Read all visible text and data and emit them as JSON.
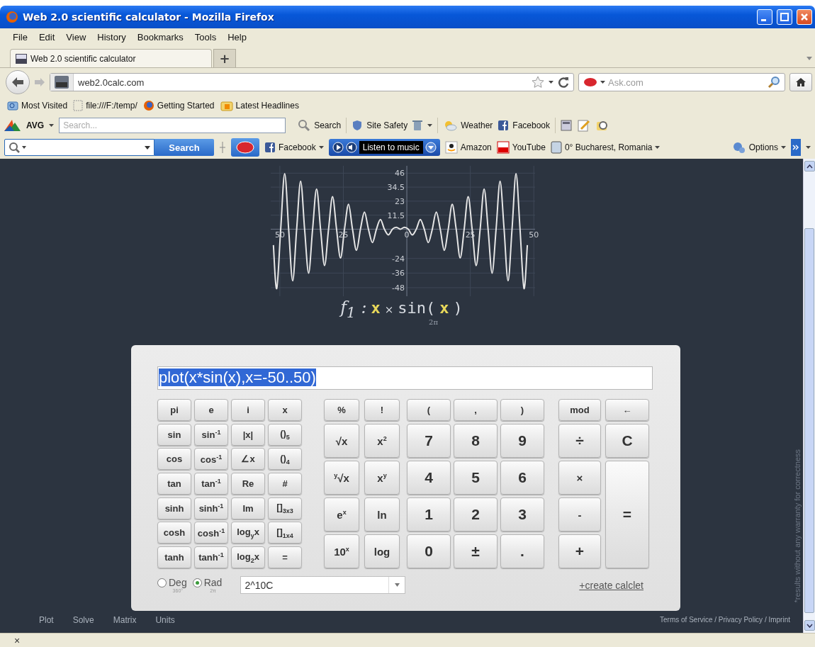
{
  "window": {
    "title": "Web 2.0 scientific calculator - Mozilla Firefox"
  },
  "menu": [
    "File",
    "Edit",
    "View",
    "History",
    "Bookmarks",
    "Tools",
    "Help"
  ],
  "tabs": [
    {
      "label": "Web 2.0 scientific calculator",
      "selected": true
    }
  ],
  "new_tab": "+",
  "address_bar": {
    "url": "web2.0calc.com"
  },
  "search_bar": {
    "placeholder": "Ask.com"
  },
  "bookmarks": [
    {
      "label": "Most Visited",
      "kind": "folder"
    },
    {
      "label": "file:///F:/temp/",
      "kind": "page"
    },
    {
      "label": "Getting Started",
      "kind": "firefox"
    },
    {
      "label": "Latest Headlines",
      "kind": "feed"
    }
  ],
  "avg_toolbar": {
    "brand": "AVG",
    "placeholder": "Search...",
    "search_button": "Search",
    "items": [
      {
        "label": "Site Safety",
        "kind": "shield"
      },
      {
        "label": "Weather",
        "kind": "weather"
      },
      {
        "label": "Facebook",
        "kind": "facebook"
      }
    ]
  },
  "ask_toolbar": {
    "search_button": "Search",
    "items": [
      {
        "label": "Facebook",
        "kind": "facebook"
      },
      {
        "label": "Listen to music",
        "kind": "music"
      },
      {
        "label": "Amazon",
        "kind": "amazon"
      },
      {
        "label": "YouTube",
        "kind": "youtube"
      },
      {
        "label": "0° Bucharest, Romania",
        "kind": "weather"
      }
    ],
    "options": "Options"
  },
  "plot": {
    "chart_data": {
      "type": "line",
      "xlim": [
        -53.6,
        50.5
      ],
      "ylim": [
        -55,
        52
      ],
      "x": [
        -52.55,
        -51.24,
        -49.67,
        -48.1,
        -46.53,
        -44.96,
        -43.39,
        -41.82,
        -40.25,
        -38.68,
        -37.11,
        -35.54,
        -33.97,
        -32.4,
        -30.82,
        -29.25,
        -27.68,
        -26.11,
        -24.54,
        -22.97,
        -21.4,
        -19.83,
        -18.26,
        -16.69,
        -15.12,
        -13.55,
        -11.97,
        -10.4,
        -8.83,
        -7.26,
        -5.69,
        -4.12,
        -2.55,
        -0.98,
        0.59,
        2.16,
        3.73,
        5.3,
        6.87,
        8.45,
        10.02,
        11.59,
        13.16,
        14.73,
        16.3,
        17.87,
        19.44,
        21.01,
        22.58,
        24.15,
        25.72,
        27.3,
        28.87,
        30.44,
        32.01,
        33.58,
        35.15,
        36.72,
        38.29,
        39.86,
        41.43,
        43,
        44.57,
        46.14,
        47.45
      ],
      "series": [
        {
          "color": "#e6e6e6",
          "values": [
            -13.1,
            -48.7,
            0,
            45.6,
            0,
            -42.4,
            0,
            39.3,
            0,
            -36.1,
            0,
            33,
            0,
            -29.9,
            0,
            26.7,
            0,
            -23.6,
            0,
            20.4,
            0,
            -17.3,
            0,
            14.1,
            0,
            -11,
            0,
            7.9,
            0,
            -4.7,
            0,
            1.6,
            0,
            1.6,
            0,
            -4.7,
            0,
            7.9,
            0,
            -11,
            0,
            14.1,
            0,
            -17.3,
            0,
            20.4,
            0,
            -23.6,
            0,
            26.7,
            0,
            -29.9,
            0,
            33,
            0,
            -36.1,
            0,
            39.3,
            0,
            -42.4,
            0,
            45.6,
            0,
            -48.7,
            -13.1
          ]
        }
      ],
      "grid": true,
      "xticks": [
        {
          "value": -50,
          "label": "50"
        },
        {
          "value": -25,
          "label": "25"
        },
        0,
        25,
        50
      ],
      "yticks": [
        46,
        34.5,
        23,
        11.5,
        -24,
        -36,
        -48
      ]
    },
    "formula": [
      {
        "text": "f$_{1}$ :",
        "kind": "name"
      },
      {
        "text": "x",
        "kind": "var"
      },
      {
        "text": "×",
        "kind": "op"
      },
      {
        "text": "sin(",
        "kind": "func"
      },
      {
        "text": "x",
        "kind": "var"
      },
      {
        "text": ")",
        "kind": "func"
      }
    ],
    "formula_note": "2π"
  },
  "calculator": {
    "input": "plot(x*sin(x),x=-50..50)",
    "input_selected": true,
    "functions": [
      "pi",
      "e",
      "i",
      "x",
      "sin",
      "sin$^{-1}$",
      "|x|",
      "()$_{5}$",
      "cos",
      "cos$^{-1}$",
      "∠x",
      "()$_{4}$",
      "tan",
      "tan$^{-1}$",
      "Re",
      "#",
      "sinh",
      "sinh$^{-1}$",
      "Im",
      "[]$_{3x3}$",
      "cosh",
      "cosh$^{-1}$",
      "log$_{y}$x",
      "[]$_{1x4}$",
      "tanh",
      "tanh$^{-1}$",
      "log$_{2}$x",
      "="
    ],
    "scientific": [
      {
        "label": "%",
        "kind": "sym"
      },
      {
        "label": "!",
        "kind": "sym"
      },
      {
        "label": "√x",
        "kind": "op"
      },
      {
        "label": "x$^{2}$",
        "kind": "op"
      },
      {
        "label": "$^{y}$√x",
        "kind": "op"
      },
      {
        "label": "x$^{y}$",
        "kind": "op"
      },
      {
        "label": "e$^{x}$",
        "kind": "op"
      },
      {
        "label": "ln",
        "kind": "op"
      },
      {
        "label": "10$^{x}$",
        "kind": "op"
      },
      {
        "label": "log",
        "kind": "op"
      }
    ],
    "numbers": [
      {
        "label": "(",
        "kind": "sym"
      },
      {
        "label": ",",
        "kind": "sym"
      },
      {
        "label": ")",
        "kind": "sym"
      },
      {
        "label": "7",
        "kind": "digit"
      },
      {
        "label": "8",
        "kind": "digit"
      },
      {
        "label": "9",
        "kind": "digit"
      },
      {
        "label": "4",
        "kind": "digit"
      },
      {
        "label": "5",
        "kind": "digit"
      },
      {
        "label": "6",
        "kind": "digit"
      },
      {
        "label": "1",
        "kind": "digit"
      },
      {
        "label": "2",
        "kind": "digit"
      },
      {
        "label": "3",
        "kind": "digit"
      },
      {
        "label": "0",
        "kind": "digit"
      },
      {
        "label": "±",
        "kind": "digit"
      },
      {
        "label": ".",
        "kind": "digit"
      }
    ],
    "operators": [
      {
        "label": "mod",
        "kind": "sym"
      },
      {
        "label": "←",
        "kind": "sym"
      },
      {
        "label": "÷",
        "kind": "digit"
      },
      {
        "label": "C",
        "kind": "digit"
      },
      {
        "label": "×",
        "kind": "op"
      },
      {
        "label": "-",
        "kind": "op"
      },
      {
        "label": "=",
        "kind": "tall"
      },
      {
        "label": "+",
        "kind": "digit"
      }
    ],
    "angle_modes": [
      {
        "label": "Deg",
        "note": "360°",
        "selected": false
      },
      {
        "label": "Rad",
        "note": "2π",
        "selected": true
      }
    ],
    "history": "2^10C",
    "create_link": "+create calclet"
  },
  "page_links": [
    "Plot",
    "Solve",
    "Matrix",
    "Units"
  ],
  "footer": "Terms of Service / Privacy Policy / Imprint",
  "disclaimer": "*results without any warranty for correctness",
  "status_bar": {
    "close": "×"
  }
}
